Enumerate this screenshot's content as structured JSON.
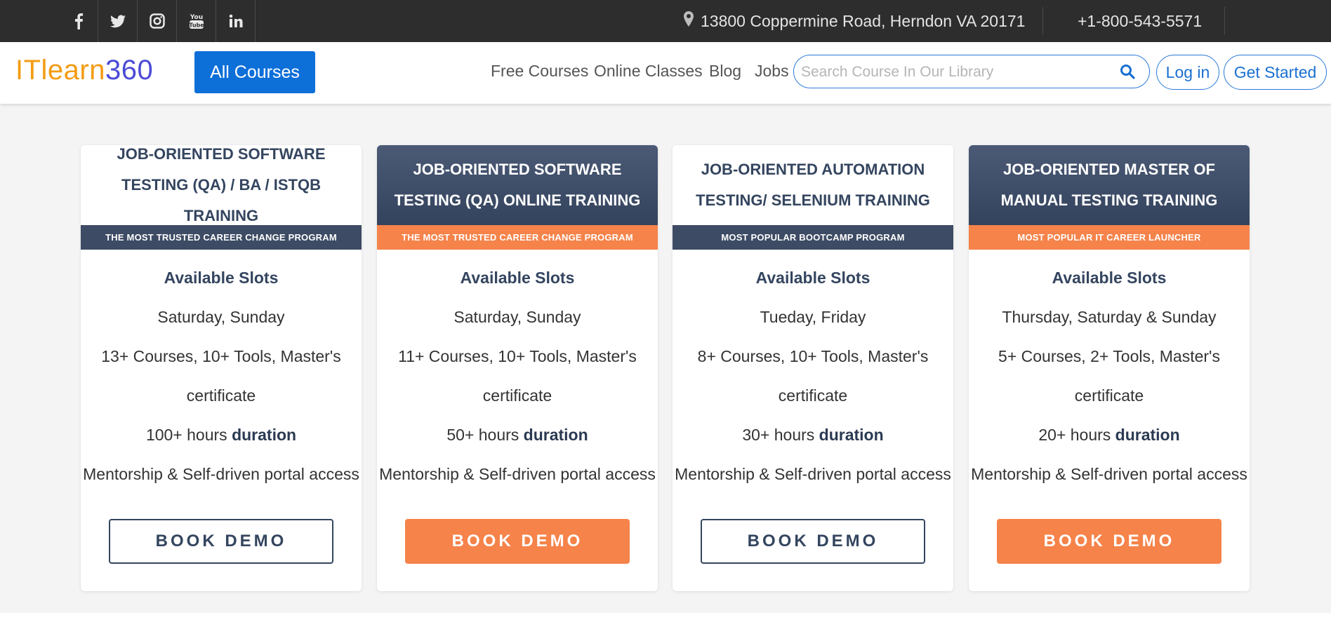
{
  "topbar": {
    "social": [
      {
        "icon": "facebook-icon"
      },
      {
        "icon": "twitter-icon"
      },
      {
        "icon": "instagram-icon"
      },
      {
        "icon": "youtube-icon"
      },
      {
        "icon": "linkedin-icon"
      }
    ],
    "address": "13800 Coppermine Road, Herndon VA 20171",
    "phone": "+1-800-543-5571"
  },
  "nav": {
    "logo_part1": "ITlearn",
    "logo_part2": "360",
    "all_courses": "All Courses",
    "links": [
      "Free Courses",
      "Online Classes",
      "Blog",
      "Jobs"
    ],
    "search_placeholder": "Search Course In Our Library",
    "login": "Log in",
    "get_started": "Get Started"
  },
  "colors": {
    "brand_orange": "#f39c12",
    "brand_blue": "#4b4bd6",
    "primary_button": "#0d6fd8",
    "card_dark": "#3d4b64",
    "accent_orange": "#f5834a"
  },
  "cards": [
    {
      "title": "JOB-ORIENTED SOFTWARE TESTING (QA) / BA / ISTQB TRAINING",
      "ribbon": "THE MOST TRUSTED CAREER CHANGE PROGRAM",
      "slots_heading": "Available Slots",
      "days": "Saturday, Sunday",
      "courses": "13+ Courses, 10+ Tools, Master's certificate",
      "hours": "100+ hours",
      "duration_label": "duration",
      "access": "Mentorship & Self-driven portal access",
      "button": "BOOK DEMO"
    },
    {
      "title": "JOB-ORIENTED SOFTWARE TESTING (QA) ONLINE TRAINING",
      "ribbon": "THE MOST TRUSTED CAREER CHANGE PROGRAM",
      "slots_heading": "Available Slots",
      "days": "Saturday, Sunday",
      "courses": "11+ Courses, 10+ Tools, Master's certificate",
      "hours": "50+ hours",
      "duration_label": "duration",
      "access": "Mentorship & Self-driven portal access",
      "button": "BOOK DEMO"
    },
    {
      "title": "JOB-ORIENTED AUTOMATION TESTING/ SELENIUM TRAINING",
      "ribbon": "MOST POPULAR BOOTCAMP PROGRAM",
      "slots_heading": "Available Slots",
      "days": "Tueday, Friday",
      "courses": "8+ Courses, 10+ Tools, Master's certificate",
      "hours": "30+ hours",
      "duration_label": "duration",
      "access": "Mentorship & Self-driven portal access",
      "button": "BOOK DEMO"
    },
    {
      "title": "JOB-ORIENTED MASTER OF MANUAL TESTING TRAINING",
      "ribbon": "MOST POPULAR IT CAREER LAUNCHER",
      "slots_heading": "Available Slots",
      "days": "Thursday, Saturday & Sunday",
      "courses": "5+ Courses, 2+ Tools, Master's certificate",
      "hours": "20+ hours",
      "duration_label": "duration",
      "access": "Mentorship & Self-driven portal access",
      "button": "BOOK DEMO"
    }
  ]
}
